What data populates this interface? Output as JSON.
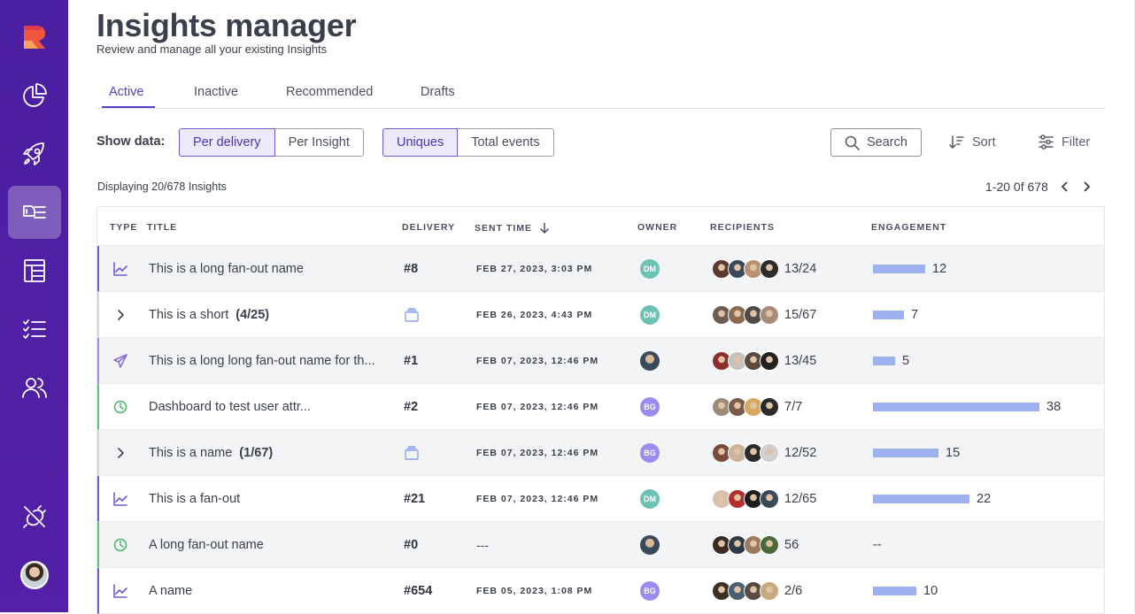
{
  "colors": {
    "sidebar": "#4a1fa0",
    "accent": "#5b3fc4",
    "bar": "#9fb0ef"
  },
  "sidebar": {
    "items": [
      {
        "icon": "pie-chart-icon"
      },
      {
        "icon": "rocket-icon"
      },
      {
        "icon": "insights-manager-icon",
        "active": true
      },
      {
        "icon": "layout-icon"
      },
      {
        "icon": "checklist-icon"
      },
      {
        "icon": "users-icon"
      },
      {
        "icon": "plug-off-icon"
      }
    ]
  },
  "header": {
    "title": "Insights manager",
    "subtitle": "Review and manage all your existing Insights"
  },
  "tabs": [
    {
      "label": "Active",
      "active": true
    },
    {
      "label": "Inactive"
    },
    {
      "label": "Recommended"
    },
    {
      "label": "Drafts"
    }
  ],
  "toolbar": {
    "show_label": "Show data:",
    "per_delivery": "Per delivery",
    "per_insight": "Per Insight",
    "uniques": "Uniques",
    "total_events": "Total events",
    "search": "Search",
    "sort": "Sort",
    "filter": "Filter"
  },
  "summary": {
    "displaying": "Displaying 20/678 Insights",
    "range": "1-20 0f 678"
  },
  "table": {
    "headers": {
      "type": "TYPE",
      "title": "TITLE",
      "delivery": "DELIVERY",
      "sent_time": "SENT TIME",
      "owner": "OWNER",
      "recipients": "RECIPIENTS",
      "engagement": "ENGAGEMENT"
    },
    "rows": [
      {
        "type": "trend-icon",
        "title": "This is a long fan-out name",
        "delivery": "#8",
        "sent": "FEB 27, 2023, 3:03 PM",
        "owner": "DM",
        "recipients": "13/24",
        "engagement": "12",
        "eng_value": 12
      },
      {
        "type": "chevron-right-icon",
        "title": "This is a short",
        "count": "(4/25)",
        "delivery_icon": "stack-icon",
        "sent": "FEB 26, 2023, 4:43 PM",
        "owner": "DM",
        "recipients": "15/67",
        "engagement": "7",
        "eng_value": 7
      },
      {
        "type": "send-icon",
        "title": "This is a long long fan-out name for th...",
        "delivery": "#1",
        "sent": "FEB 07, 2023, 12:46 PM",
        "owner": "photo",
        "recipients": "13/45",
        "engagement": "5",
        "eng_value": 5
      },
      {
        "type": "clock-icon",
        "title": "Dashboard to test user attr...",
        "delivery": "#2",
        "sent": "FEB 07, 2023, 12:46 PM",
        "owner": "BG",
        "recipients": "7/7",
        "engagement": "38",
        "eng_value": 38
      },
      {
        "type": "chevron-right-icon",
        "title": "This is a name",
        "count": "(1/67)",
        "delivery_icon": "stack-icon",
        "sent": "FEB 07, 2023, 12:46 PM",
        "owner": "BG",
        "recipients": "12/52",
        "engagement": "15",
        "eng_value": 15
      },
      {
        "type": "trend-icon",
        "title": "This is a fan-out",
        "delivery": "#21",
        "sent": "FEB 07, 2023, 12:46 PM",
        "owner": "DM",
        "recipients": "12/65",
        "engagement": "22",
        "eng_value": 22
      },
      {
        "type": "clock-icon",
        "title": "A long fan-out name",
        "delivery": "#0",
        "sent": "---",
        "owner": "photo",
        "recipients": "56",
        "engagement": "--",
        "eng_value": 0
      },
      {
        "type": "trend-icon",
        "title": "A name",
        "delivery": "#654",
        "sent": "FEB 05, 2023, 1:08 PM",
        "owner": "BG",
        "recipients": "2/6",
        "engagement": "10",
        "eng_value": 10
      }
    ]
  }
}
